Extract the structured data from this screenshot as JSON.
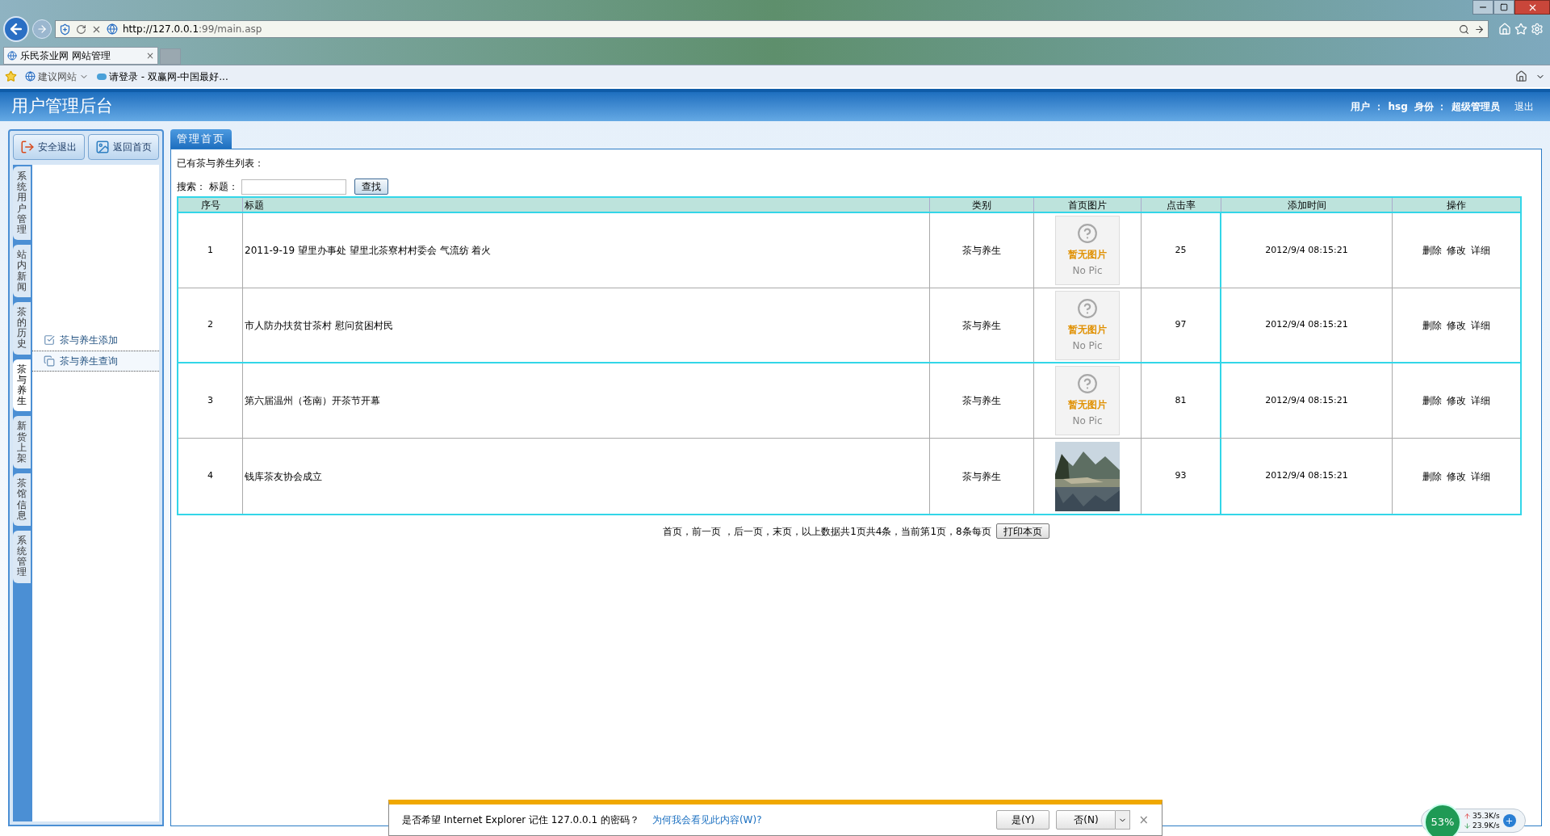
{
  "browser": {
    "url_host": "http://127.0.0.1",
    "url_rest": ":99/main.asp",
    "tab_title": "乐民茶业网 网站管理",
    "tab_close": "×",
    "favorites": [
      {
        "label": "建议网站",
        "kind": "dropdown"
      },
      {
        "label": "请登录 - 双赢网-中国最好...",
        "kind": "link"
      }
    ]
  },
  "header": {
    "title": "用户管理后台",
    "user_label": "用户 ：",
    "user": "hsg",
    "role_label": "身份 ：",
    "role": "超级管理员",
    "logout": "退出"
  },
  "sidebar": {
    "buttons": [
      {
        "label": "安全退出",
        "kind": "exit"
      },
      {
        "label": "返回首页",
        "kind": "home"
      }
    ],
    "tabs": [
      {
        "label": "系统用户管理",
        "selected": false
      },
      {
        "label": "站内新闻",
        "selected": false
      },
      {
        "label": "茶的历史",
        "selected": false
      },
      {
        "label": "茶与养生",
        "selected": true
      },
      {
        "label": "新货上架",
        "selected": false
      },
      {
        "label": "茶馆信息",
        "selected": false
      },
      {
        "label": "系统管理",
        "selected": false
      }
    ],
    "items": [
      {
        "label": "茶与养生添加",
        "selected": false,
        "kind": "add"
      },
      {
        "label": "茶与养生查询",
        "selected": true,
        "kind": "query"
      }
    ]
  },
  "content": {
    "tab": "管理首页",
    "heading": "已有茶与养生列表：",
    "search_label": "搜索：",
    "field_label": "标题：",
    "search_button": "查找",
    "table": {
      "columns": [
        "序号",
        "标题",
        "类别",
        "首页图片",
        "点击率",
        "添加时间",
        "操作"
      ],
      "rows": [
        {
          "no": "1",
          "title": "2011-9-19 望里办事处 望里北茶寮村村委会 气流纺 着火",
          "category": "茶与养生",
          "image": {
            "kind": "no_pic",
            "label": "暂无图片",
            "sublabel": "No Pic"
          },
          "clicks": "25",
          "time": "2012/9/4 08:15:21",
          "actions": [
            "删除",
            "修改",
            "详细"
          ]
        },
        {
          "no": "2",
          "title": "市人防办扶贫甘茶村 慰问贫困村民",
          "category": "茶与养生",
          "image": {
            "kind": "no_pic",
            "label": "暂无图片",
            "sublabel": "No Pic"
          },
          "clicks": "97",
          "time": "2012/9/4 08:15:21",
          "actions": [
            "删除",
            "修改",
            "详细"
          ]
        },
        {
          "no": "3",
          "title": "第六届温州（苍南）开茶节开幕",
          "category": "茶与养生",
          "image": {
            "kind": "no_pic",
            "label": "暂无图片",
            "sublabel": "No Pic"
          },
          "clicks": "81",
          "time": "2012/9/4 08:15:21",
          "actions": [
            "删除",
            "修改",
            "详细"
          ]
        },
        {
          "no": "4",
          "title": "钱库茶友协会成立",
          "category": "茶与养生",
          "image": {
            "kind": "picture"
          },
          "clicks": "93",
          "time": "2012/9/4 08:15:21",
          "actions": [
            "删除",
            "修改",
            "详细"
          ]
        }
      ]
    },
    "pager": "首页，前一页 ，后一页，末页，以上数据共1页共4条，当前第1页，8条每页",
    "print_button": "打印本页"
  },
  "password_bar": {
    "message": "是否希望 Internet Explorer 记住 127.0.0.1 的密码？",
    "link": "为何我会看见此内容(W)?",
    "yes": "是(Y)",
    "no": "否(N)",
    "close": "×"
  },
  "net_widget": {
    "percent": "53%",
    "up": "35.3K/s",
    "down": "23.9K/s"
  }
}
